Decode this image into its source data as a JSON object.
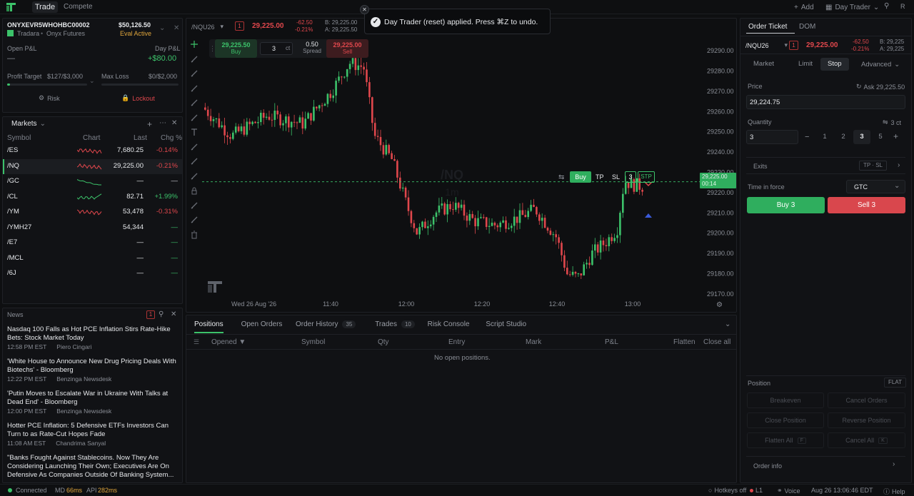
{
  "topbar": {
    "tab_trade": "Trade",
    "tab_compete": "Compete",
    "add": "Add",
    "layout": "Day Trader",
    "avatar": "R"
  },
  "toast": {
    "message": "Day Trader (reset) applied. Press ⌘Z to undo."
  },
  "account": {
    "id": "ONYXEVR5WHOHBC00002",
    "balance": "$50,126.50",
    "broker": "Tradara",
    "firm": "Onyx Futures",
    "status": "Eval Active",
    "open_pnl_label": "Open P&L",
    "open_pnl_value": "—",
    "day_pnl_label": "Day P&L",
    "day_pnl_value": "+$80.00",
    "profit_target_label": "Profit Target",
    "profit_target_value": "$127/$3,000",
    "max_loss_label": "Max Loss",
    "max_loss_value": "$0/$2,000",
    "risk_label": "Risk",
    "lockout_label": "Lockout",
    "profit_target_progress": 0.04
  },
  "markets": {
    "title": "Markets",
    "headers": {
      "symbol": "Symbol",
      "chart": "Chart",
      "last": "Last",
      "chg": "Chg %"
    },
    "rows": [
      {
        "symbol": "/ES",
        "last": "7,680.25",
        "chg": "-0.14%",
        "dir": "down"
      },
      {
        "symbol": "/NQ",
        "last": "29,225.00",
        "chg": "-0.21%",
        "dir": "down"
      },
      {
        "symbol": "/GC",
        "last": "—",
        "chg": "—",
        "dir": "flat"
      },
      {
        "symbol": "/CL",
        "last": "82.71",
        "chg": "+1.99%",
        "dir": "up"
      },
      {
        "symbol": "/YM",
        "last": "53,478",
        "chg": "-0.31%",
        "dir": "down"
      },
      {
        "symbol": "/YMH27",
        "last": "54,344",
        "chg": "—",
        "dir": "none"
      },
      {
        "symbol": "/E7",
        "last": "—",
        "chg": "—",
        "dir": "none"
      },
      {
        "symbol": "/MCL",
        "last": "—",
        "chg": "—",
        "dir": "none"
      },
      {
        "symbol": "/6J",
        "last": "—",
        "chg": "—",
        "dir": "none"
      }
    ]
  },
  "news": {
    "title": "News",
    "badge": "1",
    "items": [
      {
        "headline": "Nasdaq 100 Falls as Hot PCE Inflation Stirs Rate-Hike Bets: Stock Market Today",
        "time": "12:58 PM EST",
        "source": "Piero Cingari"
      },
      {
        "headline": "'White House to Announce New Drug Pricing Deals With Biotechs' - Bloomberg",
        "time": "12:22 PM EST",
        "source": "Benzinga Newsdesk"
      },
      {
        "headline": "'Putin Moves to Escalate War in Ukraine With Talks at Dead End' - Bloomberg",
        "time": "12:00 PM EST",
        "source": "Benzinga Newsdesk"
      },
      {
        "headline": "Hotter PCE Inflation: 5 Defensive ETFs Investors Can Turn to as Rate-Cut Hopes Fade",
        "time": "11:08 AM EST",
        "source": "Chandrima Sanyal"
      },
      {
        "headline": "\"Banks Fought Against Stablecoins. Now They Are Considering Launching Their Own; Executives Are On Defensive As Companies Outside Of Banking System...",
        "time": "",
        "source": ""
      }
    ]
  },
  "chart_header": {
    "symbol": "/NQU26",
    "qty_badge": "1",
    "price": "29,225.00",
    "chg": "-62.50",
    "chg_pct": "-0.21%",
    "bid": "B: 29,225.00",
    "ask": "A: 29,225.50"
  },
  "chart_trade": {
    "buy_price": "29,225.50",
    "buy_label": "Buy",
    "qty": "3",
    "ct": "ct",
    "spread": "0.50",
    "spread_label": "Spread",
    "sell_price": "29,225.00",
    "sell_label": "Sell"
  },
  "chart": {
    "watermark_symbol": "/NQ",
    "watermark_tf": "1m",
    "price_ticks": [
      "29290.00",
      "29280.00",
      "29270.00",
      "29260.00",
      "29250.00",
      "29240.00",
      "29230.00",
      "29220.00",
      "29210.00",
      "29200.00",
      "29190.00",
      "29180.00",
      "29170.00"
    ],
    "time_ticks": [
      "Wed 26 Aug '26",
      "11:40",
      "12:00",
      "12:20",
      "12:40",
      "13:00"
    ],
    "last_price": "29,225.00",
    "countdown": "00:14",
    "order_buy": "Buy",
    "order_tp": "TP",
    "order_sl": "SL",
    "order_qty": "3",
    "order_type": "STP"
  },
  "chart_data": {
    "type": "candlestick",
    "y_range": [
      29164,
      29296
    ],
    "last_price": 29225,
    "x_ticks": [
      "Wed 26 Aug '26",
      "11:40",
      "12:00",
      "12:20",
      "12:40",
      "13:00"
    ]
  },
  "bottom": {
    "tabs": [
      {
        "label": "Positions",
        "count": ""
      },
      {
        "label": "Open Orders",
        "count": ""
      },
      {
        "label": "Order History",
        "count": "35"
      },
      {
        "label": "Trades",
        "count": "10"
      },
      {
        "label": "Risk Console",
        "count": ""
      },
      {
        "label": "Script Studio",
        "count": ""
      }
    ],
    "cols": {
      "opened": "Opened ▼",
      "symbol": "Symbol",
      "qty": "Qty",
      "entry": "Entry",
      "mark": "Mark",
      "pnl": "P&L",
      "flatten": "Flatten",
      "close_all": "Close all"
    },
    "empty": "No open positions."
  },
  "ticket": {
    "tab_ticket": "Order Ticket",
    "tab_dom": "DOM",
    "symbol": "/NQU26",
    "qty_badge": "1",
    "price": "29,225.00",
    "chg": "-62.50",
    "chg_pct": "-0.21%",
    "bid": "B: 29,225",
    "ask": "A: 29,225",
    "types": [
      "Market",
      "Limit",
      "Stop"
    ],
    "advanced": "Advanced",
    "price_label": "Price",
    "ask_link": "Ask 29,225.50",
    "price_value": "29,224.75",
    "qty_label": "Quantity",
    "qty_unit": "3 ct",
    "qty_value": "3",
    "presets": [
      "1",
      "2",
      "3",
      "5"
    ],
    "exits_label": "Exits",
    "exits_value": "TP · SL",
    "tif_label": "Time in force",
    "tif_value": "GTC",
    "buy_btn": "Buy 3",
    "sell_btn": "Sell 3",
    "position_label": "Position",
    "position_value": "FLAT",
    "breakeven": "Breakeven",
    "cancel_orders": "Cancel Orders",
    "close_position": "Close Position",
    "reverse_position": "Reverse Position",
    "flatten_all": "Flatten All",
    "flatten_key": "F",
    "cancel_all": "Cancel All",
    "cancel_key": "K",
    "order_info": "Order info"
  },
  "statusbar": {
    "connected": "Connected",
    "md_label": "MD",
    "md_value": "66ms",
    "api_label": "API",
    "api_value": "282ms",
    "hotkeys": "Hotkeys off",
    "level": "L1",
    "voice": "Voice",
    "datetime": "Aug 26 13:06:46 EDT",
    "help": "Help"
  },
  "colors": {
    "up": "#3cc26a",
    "down": "#e0474c",
    "accent_buy": "#2fae5e",
    "accent_sell": "#d9474d"
  }
}
